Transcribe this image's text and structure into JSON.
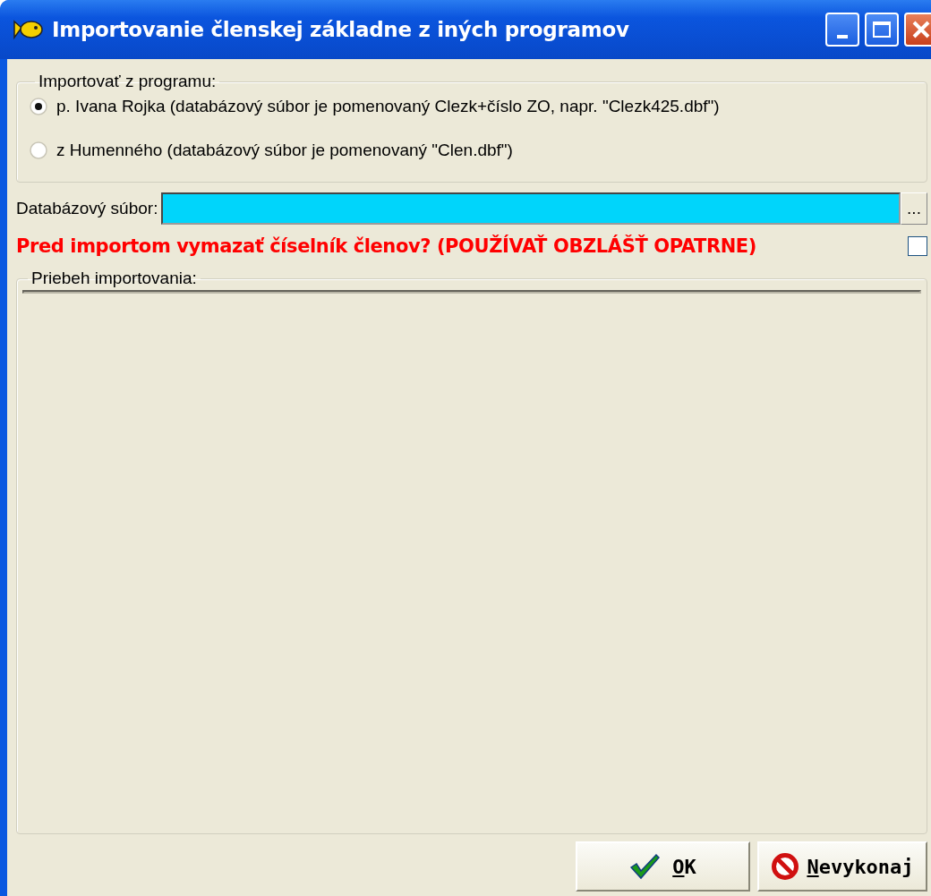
{
  "window": {
    "title": "Importovanie členskej základne z iných programov"
  },
  "source_group": {
    "title": "Importovať z programu:",
    "options": [
      {
        "label": "p. Ivana Rojka (databázový súbor je pomenovaný Clezk+číslo ZO, napr. \"Clezk425.dbf\")",
        "selected": true
      },
      {
        "label": "z Humenného (databázový súbor je pomenovaný \"Clen.dbf\")",
        "selected": false
      }
    ]
  },
  "file_field": {
    "label": "Databázový súbor:",
    "browse": "..."
  },
  "clear_option": {
    "label": "Pred importom vymazať číselník členov? (POUŽÍVAŤ OBZLÁŠŤ OPATRNE)",
    "checked": false
  },
  "progress_group": {
    "title": "Priebeh importovania:"
  },
  "buttons": [
    {
      "kind": "ok",
      "label": "OK",
      "mnemonic": true
    },
    {
      "kind": "cancel",
      "label": "Nevykonaj",
      "mnemonic": true
    }
  ]
}
